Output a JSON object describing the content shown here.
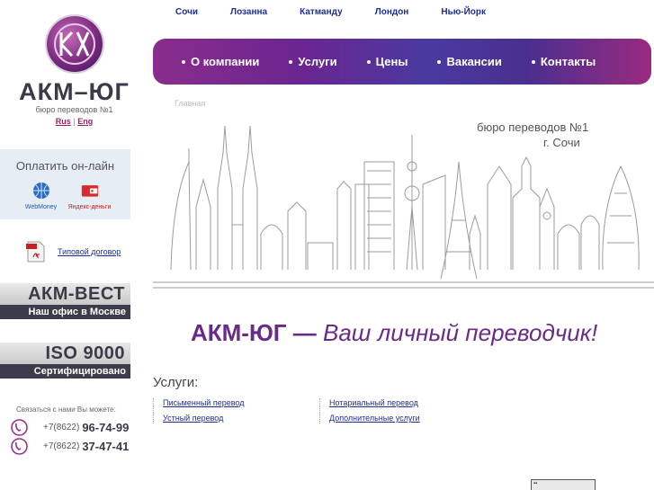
{
  "cities": [
    "Сочи",
    "Лозанна",
    "Катманду",
    "Лондон",
    "Нью-Йорк"
  ],
  "logo": {
    "name": "АКМ–ЮГ",
    "subtitle": "бюро переводов №1",
    "lang_ru": "Rus",
    "lang_sep": "|",
    "lang_en": "Eng"
  },
  "nav": [
    "О компании",
    "Услуги",
    "Цены",
    "Вакансии",
    "Контакты"
  ],
  "breadcrumb": "Главная",
  "tagline": {
    "line1": "бюро переводов №1",
    "line2": "г. Сочи"
  },
  "payment": {
    "title": "Оплатить он-лайн",
    "webmoney": "WebMoney",
    "yandex": "Яндекс-деньги"
  },
  "contract_link": "Типовой договор",
  "badge_west": {
    "title": "АКМ-ВЕСТ",
    "subtitle": "Наш офис в Москве"
  },
  "badge_iso": {
    "title": "ISO 9000",
    "subtitle": "Сертифицировано"
  },
  "contact": {
    "intro": "Связаться с нами Вы можете:",
    "phones": [
      {
        "prefix": "+7(8622)",
        "number": "96-74-99"
      },
      {
        "prefix": "+7(8622)",
        "number": "37-47-41"
      }
    ]
  },
  "headline": {
    "brand": "АКМ-ЮГ —",
    "slogan": "Ваш личный переводчик!"
  },
  "services": {
    "title": "Услуги:",
    "col1": [
      "Письменный перевод",
      "Устный перевод"
    ],
    "col2": [
      "Нотариальный перевод",
      "Дополнительные услуги"
    ]
  },
  "colors": {
    "accent": "#6a2a8a",
    "nav_gradient_start": "#8a2d8c",
    "nav_gradient_mid": "#4a3aa0",
    "link": "#1e2f8f"
  }
}
